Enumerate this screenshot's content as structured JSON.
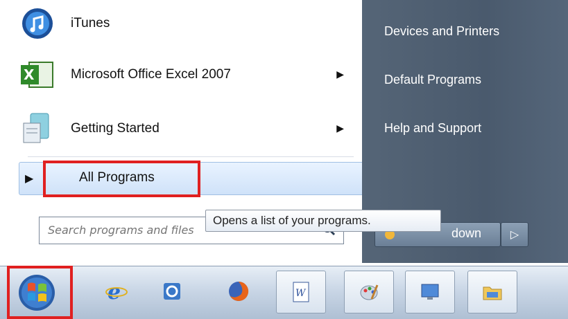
{
  "programs": [
    {
      "label": "iTunes",
      "icon": "itunes-icon",
      "has_submenu": false
    },
    {
      "label": "Microsoft Office Excel 2007",
      "icon": "excel-icon",
      "has_submenu": true
    },
    {
      "label": "Getting Started",
      "icon": "getting-started-icon",
      "has_submenu": true
    }
  ],
  "all_programs": {
    "label": "All Programs"
  },
  "search": {
    "placeholder": "Search programs and files"
  },
  "right_links": [
    "Devices and Printers",
    "Default Programs",
    "Help and Support"
  ],
  "shutdown": {
    "label": "down"
  },
  "tooltip": {
    "text": "Opens a list of your programs."
  },
  "taskbar": {
    "items": [
      "start-button",
      "internet-explorer-icon",
      "app-icon",
      "firefox-icon",
      "word-icon",
      "paint-icon",
      "remote-desktop-icon",
      "windows-explorer-icon"
    ]
  },
  "colors": {
    "highlight": "#e02020",
    "right_pane": "#4f6073",
    "selection": "#cfe2f9"
  }
}
